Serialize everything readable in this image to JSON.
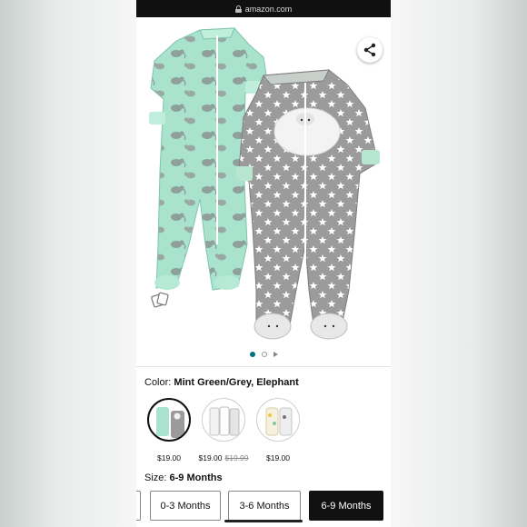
{
  "browser": {
    "url": "amazon.com"
  },
  "gallery": {
    "image_alt": "Mint green elephant sleeper and grey star sleeper with lamb applique",
    "page_indicator": {
      "current": 1,
      "total": 2,
      "has_video": true
    }
  },
  "color": {
    "label": "Color:",
    "value": "Mint Green/Grey, Elephant"
  },
  "swatches": [
    {
      "price": "$19.00",
      "list_price": "",
      "selected": true
    },
    {
      "price": "$19.00",
      "list_price": "$19.99",
      "selected": false
    },
    {
      "price": "$19.00",
      "list_price": "",
      "selected": false
    }
  ],
  "size": {
    "label": "Size:",
    "value": "6-9 Months",
    "options": [
      "0-3 Months",
      "3-6 Months",
      "6-9 Months"
    ]
  },
  "colors": {
    "accent": "#007185",
    "mint": "#a8e2cc",
    "grey": "#9a9a9a",
    "selected_bg": "#111111"
  }
}
